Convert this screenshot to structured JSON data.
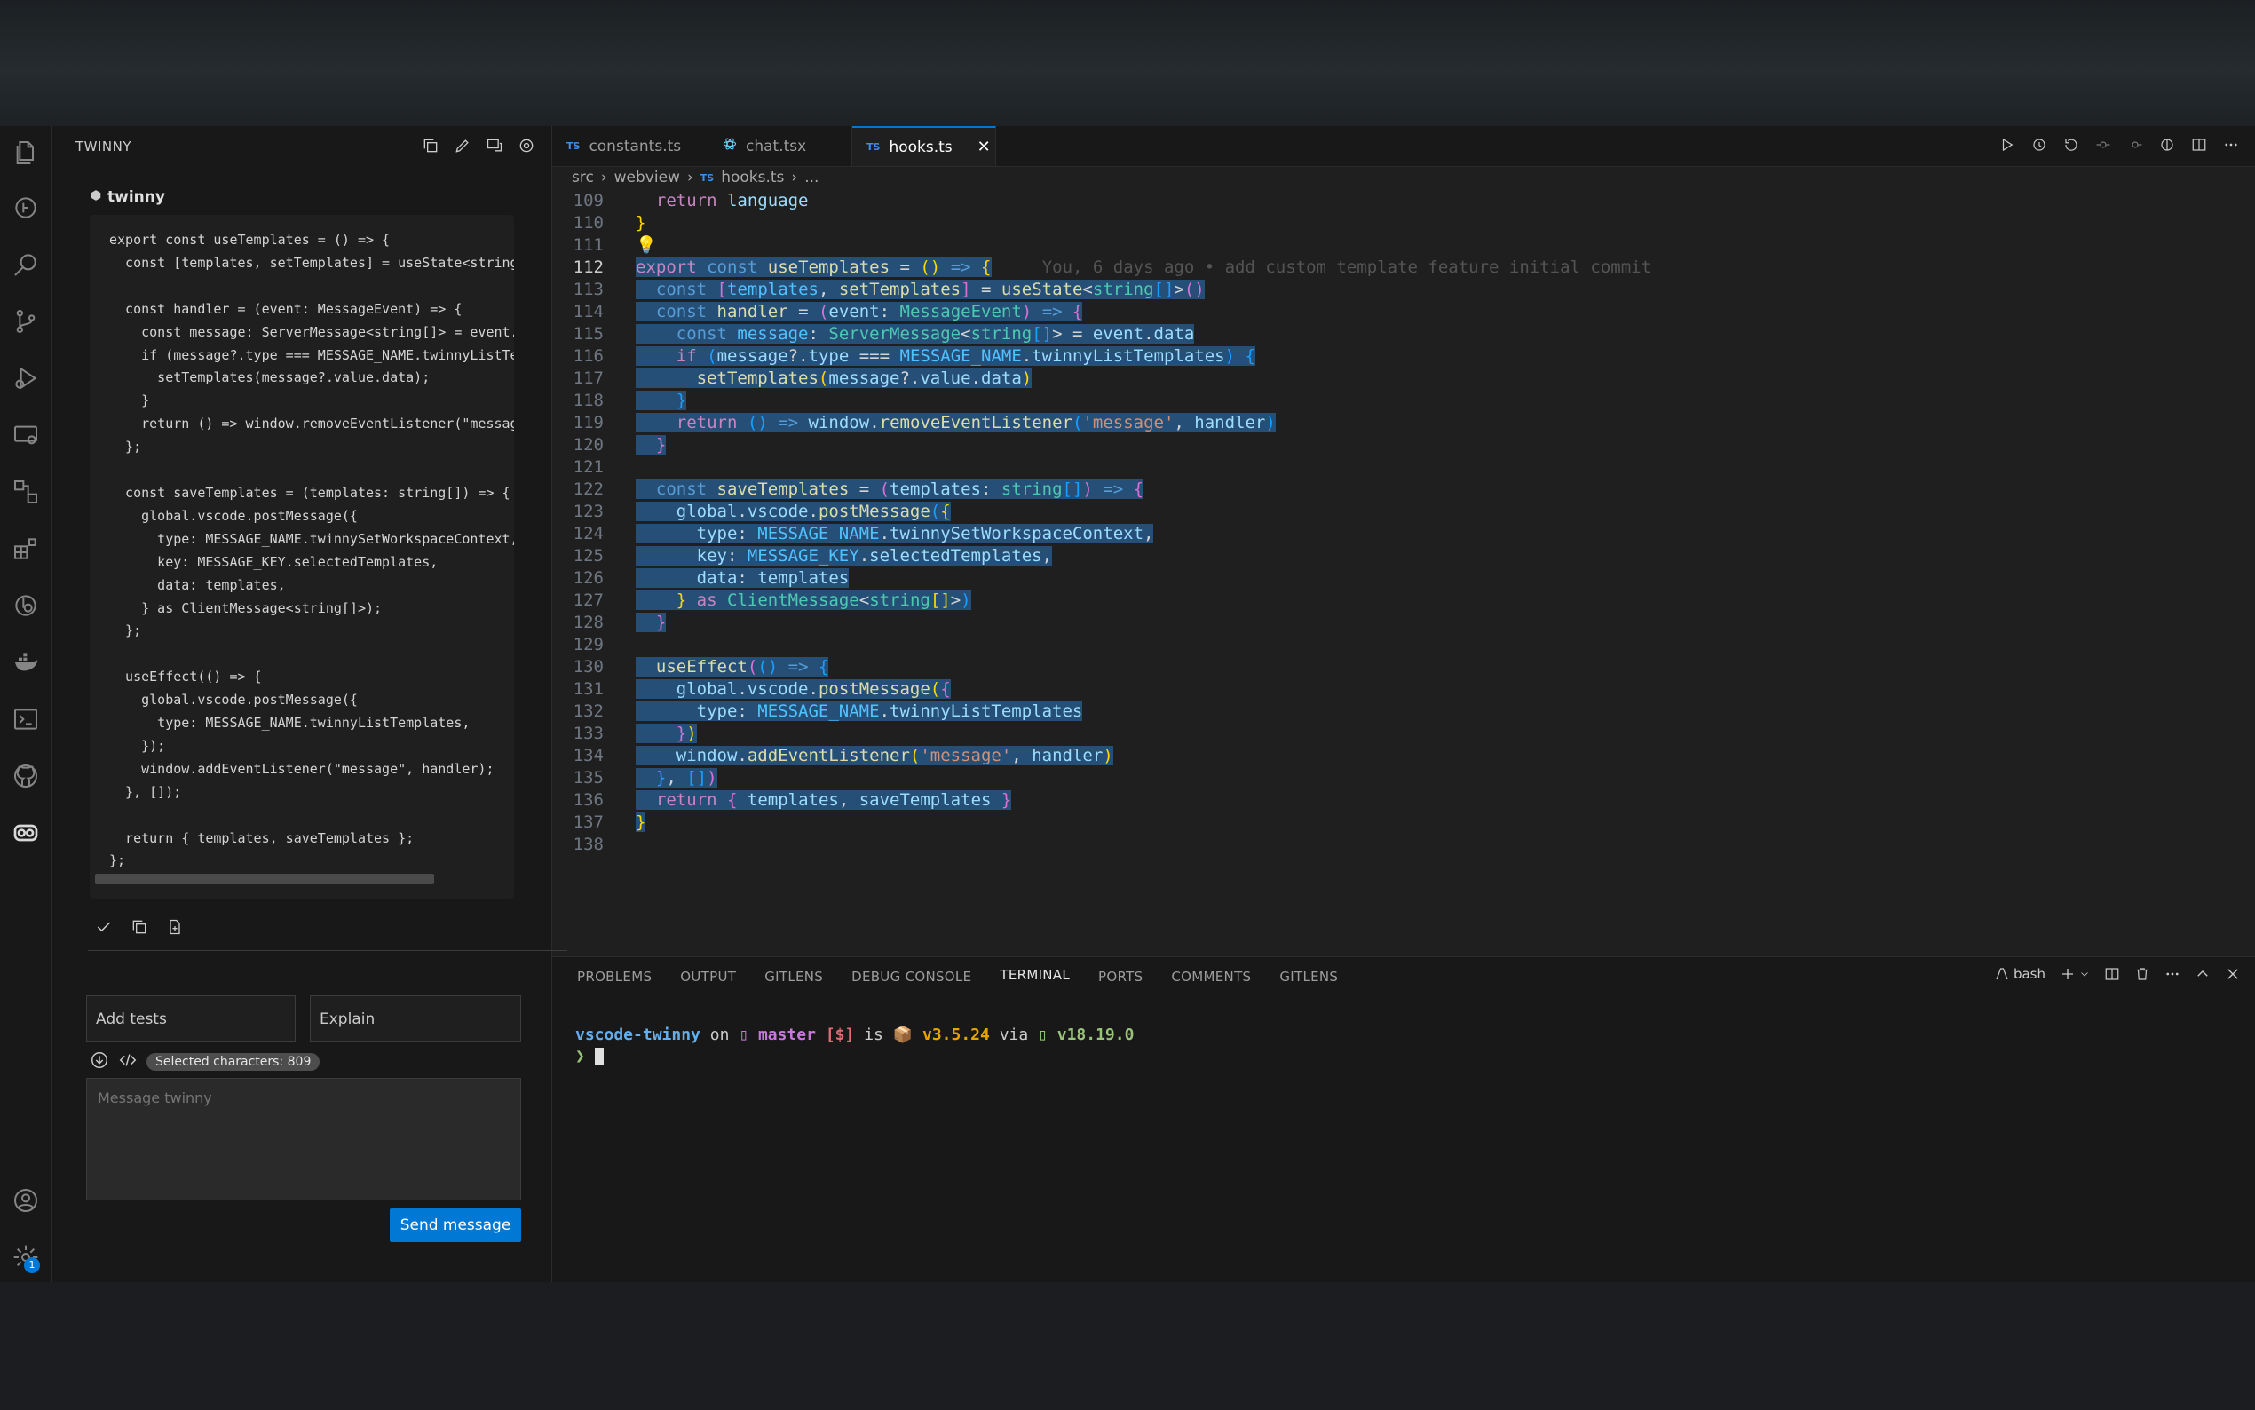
{
  "sidebar": {
    "title": "TWINNY",
    "workspace": "twinny",
    "code_lines": [
      "export const useTemplates = () => {",
      "  const [templates, setTemplates] = useState<string[]",
      "",
      "  const handler = (event: MessageEvent) => {",
      "    const message: ServerMessage<string[]> = event.da",
      "    if (message?.type === MESSAGE_NAME.twinnyListTemp",
      "      setTemplates(message?.value.data);",
      "    }",
      "    return () => window.removeEventListener(\"message\"",
      "  };",
      "",
      "  const saveTemplates = (templates: string[]) => {",
      "    global.vscode.postMessage({",
      "      type: MESSAGE_NAME.twinnySetWorkspaceContext,",
      "      key: MESSAGE_KEY.selectedTemplates,",
      "      data: templates,",
      "    } as ClientMessage<string[]>);",
      "  };",
      "",
      "  useEffect(() => {",
      "    global.vscode.postMessage({",
      "      type: MESSAGE_NAME.twinnyListTemplates,",
      "    });",
      "    window.addEventListener(\"message\", handler);",
      "  }, []);",
      "",
      "  return { templates, saveTemplates };",
      "};"
    ],
    "suggestion_1": "Add tests",
    "suggestion_2": "Explain",
    "selected_badge": "Selected characters: 809",
    "message_placeholder": "Message twinny",
    "send_label": "Send message",
    "settings_badge": "1"
  },
  "tabs": [
    {
      "label": "constants.ts",
      "icon": "TS"
    },
    {
      "label": "chat.tsx",
      "icon": "react-icon"
    },
    {
      "label": "hooks.ts",
      "icon": "TS"
    }
  ],
  "breadcrumb": {
    "seg1": "src",
    "seg2": "webview",
    "seg3": "hooks.ts",
    "seg4": "...",
    "icon": "TS"
  },
  "editor": {
    "line_numbers": [
      "109",
      "110",
      "111",
      "112",
      "113",
      "114",
      "115",
      "116",
      "117",
      "118",
      "119",
      "120",
      "121",
      "122",
      "123",
      "124",
      "125",
      "126",
      "127",
      "128",
      "129",
      "130",
      "131",
      "132",
      "133",
      "134",
      "135",
      "136",
      "137",
      "138"
    ],
    "blame": "You, 6 days ago • add custom template feature initial commit",
    "current_line": "112"
  },
  "panel": {
    "tabs": [
      "PROBLEMS",
      "OUTPUT",
      "GITLENS",
      "DEBUG CONSOLE",
      "TERMINAL",
      "PORTS",
      "COMMENTS",
      "GITLENS"
    ],
    "active_tab": "TERMINAL",
    "shell": "bash",
    "prompt": {
      "dir": "vscode-twinny",
      "on": "on",
      "branch": "master",
      "status": "[$]",
      "is": "is",
      "version": "v3.5.24",
      "via": "via",
      "node": "v18.19.0",
      "arrow": "❯"
    }
  },
  "colors": {
    "accent": "#0078d4",
    "editor_bg": "#1f1f1f",
    "sidebar_bg": "#181818",
    "selection": "#264f78"
  }
}
